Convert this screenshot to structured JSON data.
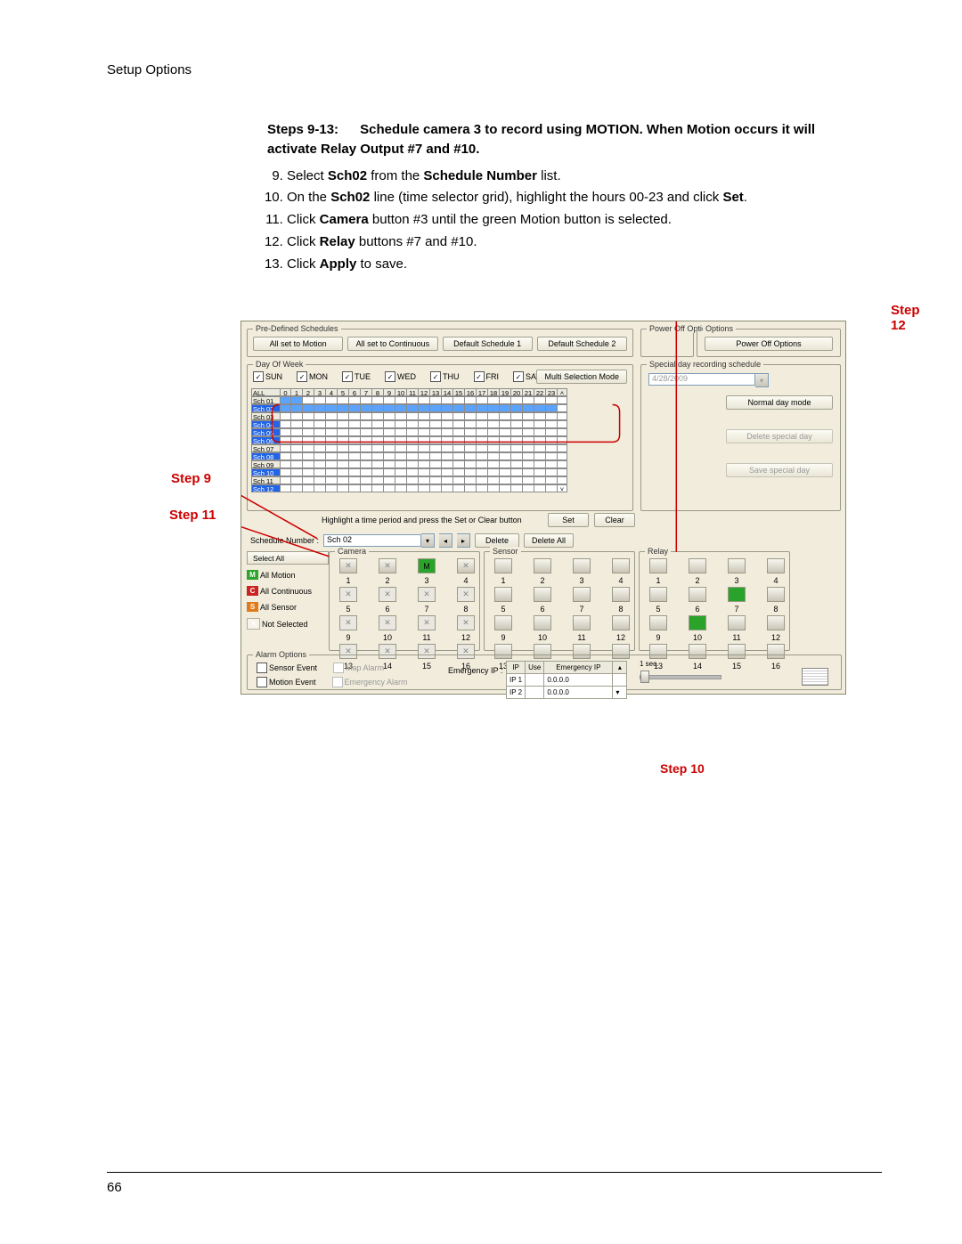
{
  "header": {
    "section": "Setup Options",
    "page_num": "66"
  },
  "instr": {
    "range": "Steps 9-13:",
    "lead": "Schedule camera 3 to record using MOTION. When Motion occurs it will activate Relay Output #7 and #10.",
    "items": [
      {
        "pre": "Select ",
        "b1": "Sch02",
        "mid": " from the ",
        "b2": "Schedule Number",
        "post": " list."
      },
      {
        "pre": "On the ",
        "b1": "Sch02",
        "mid": " line (time selector grid), highlight the hours 00-23 and click ",
        "b2": "Set",
        "post": "."
      },
      {
        "pre": "Click ",
        "b1": "Camera",
        "mid": " button #3 until the green Motion button is selected.",
        "b2": "",
        "post": ""
      },
      {
        "pre": "Click ",
        "b1": "Relay",
        "mid": " buttons #7 and #10.",
        "b2": "",
        "post": ""
      },
      {
        "pre": "Click ",
        "b1": "Apply",
        "mid": " to save.",
        "b2": "",
        "post": ""
      }
    ]
  },
  "callouts": {
    "s9": "Step 9",
    "s10": "Step 10",
    "s11": "Step 11",
    "s12": "Step 12"
  },
  "shot": {
    "group_labels": {
      "predef": "Pre-Defined Schedules",
      "dow": "Day Of Week",
      "sdrs": "Special day recording schedule",
      "power": "Power Off Options",
      "options": "Options",
      "camera": "Camera",
      "sensor": "Sensor",
      "relay": "Relay",
      "alarm": "Alarm Options"
    },
    "predef_btns": [
      "All set to Motion",
      "All set to Continuous",
      "Default Schedule 1",
      "Default Schedule 2"
    ],
    "power_off_btn": "Power Off Options",
    "days": [
      "SUN",
      "MON",
      "TUE",
      "WED",
      "THU",
      "FRI",
      "SAT"
    ],
    "msm": "Multi Selection Mode",
    "sd_date": "4/28/2009",
    "sd_btns": [
      "Normal day mode",
      "Delete special day",
      "Save special day"
    ],
    "grid": {
      "all": "ALL",
      "hours": [
        "0",
        "1",
        "2",
        "3",
        "4",
        "5",
        "6",
        "7",
        "8",
        "9",
        "10",
        "11",
        "12",
        "13",
        "14",
        "15",
        "16",
        "17",
        "18",
        "19",
        "20",
        "21",
        "22",
        "23"
      ],
      "rows": [
        "Sch 01",
        "Sch 02",
        "Sch 03",
        "Sch 04",
        "Sch 05",
        "Sch 06",
        "Sch 07",
        "Sch 08",
        "Sch 09",
        "Sch 10",
        "Sch 11",
        "Sch 12"
      ],
      "selected_rows": [
        "Sch 02",
        "Sch 04",
        "Sch 05",
        "Sch 06",
        "Sch 08",
        "Sch 10",
        "Sch 12"
      ]
    },
    "grid_help": "Highlight a time period and press the Set or Clear button",
    "set": "Set",
    "clear": "Clear",
    "schnum_label": "Schedule Number :",
    "schnum_value": "Sch 02",
    "delete": "Delete",
    "delete_all": "Delete All",
    "select_all": "Select All",
    "sel_tags": {
      "m": "M",
      "c": "C",
      "s": "S",
      "m_lbl": "All Motion",
      "c_lbl": "All Continuous",
      "s_lbl": "All Sensor",
      "n_lbl": "Not Selected"
    },
    "nums1to16": [
      "1",
      "2",
      "3",
      "4",
      "5",
      "6",
      "7",
      "8",
      "9",
      "10",
      "11",
      "12",
      "13",
      "14",
      "15",
      "16"
    ],
    "alarm": {
      "sev": "Sensor Event",
      "mev": "Motion Event",
      "map": "Map Alarm",
      "emg": "Emergency Alarm",
      "eip": "Emergency IP :",
      "th": [
        "IP",
        "Use",
        "Emergency IP"
      ],
      "r1": [
        "IP 1",
        "",
        "0.0.0.0"
      ],
      "r2": [
        "IP 2",
        "",
        "0.0.0.0"
      ],
      "sec": "1 sec."
    }
  }
}
